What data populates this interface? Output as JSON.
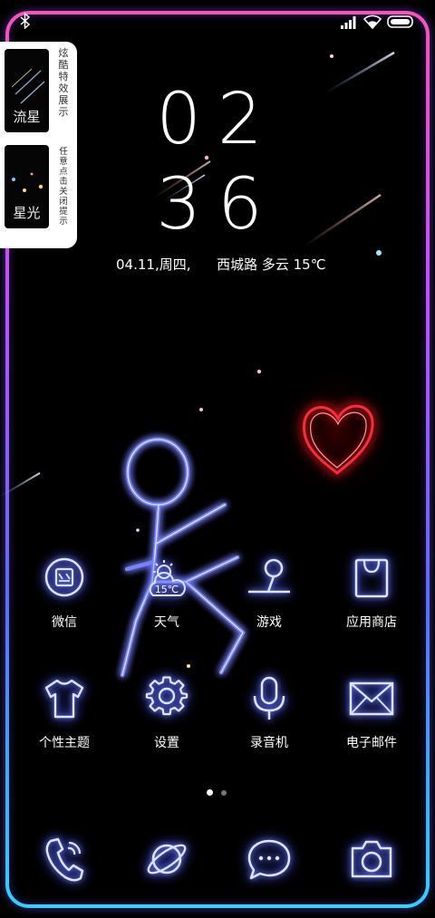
{
  "colors": {
    "neon_blue": "#6f7cff",
    "heart_red": "#ff2030",
    "frame_top": "#ff4fb8",
    "frame_bottom": "#28d6ff"
  },
  "status_bar": {
    "icons": [
      "bluetooth-icon",
      "signal-icon",
      "wifi-icon",
      "battery-icon"
    ]
  },
  "effects_panel": {
    "title": "炫酷特效展示",
    "hint": "任意点击关闭提示",
    "tiles": [
      {
        "label": "流星",
        "icon": "meteor-preview"
      },
      {
        "label": "星光",
        "icon": "starlight-preview"
      }
    ]
  },
  "clock": {
    "hour": "02",
    "minute": "36"
  },
  "date_weather": "04.11,周四,      西城路 多云 15℃",
  "apps": [
    {
      "label": "微信",
      "icon": "wechat-icon"
    },
    {
      "label": "天气",
      "icon": "weather-icon",
      "badge": "15℃"
    },
    {
      "label": "游戏",
      "icon": "game-joystick-icon"
    },
    {
      "label": "应用商店",
      "icon": "app-store-icon"
    },
    {
      "label": "个性主题",
      "icon": "tshirt-theme-icon"
    },
    {
      "label": "设置",
      "icon": "gear-icon"
    },
    {
      "label": "录音机",
      "icon": "microphone-icon"
    },
    {
      "label": "电子邮件",
      "icon": "envelope-icon"
    }
  ],
  "pager": {
    "pages": 2,
    "current": 1
  },
  "dock": [
    {
      "icon": "phone-icon"
    },
    {
      "icon": "browser-icon"
    },
    {
      "icon": "message-bubble-icon"
    },
    {
      "icon": "camera-icon"
    }
  ]
}
